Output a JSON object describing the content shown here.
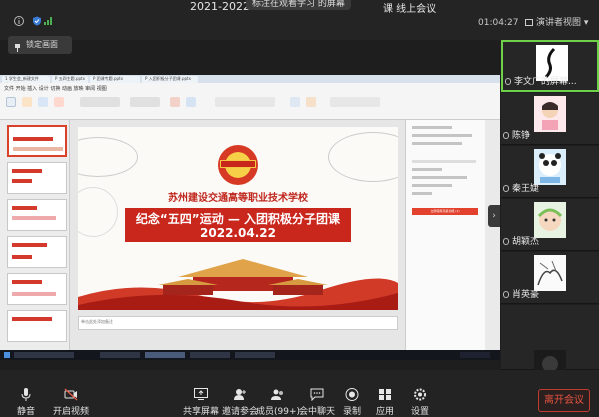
{
  "window": {
    "title_left": "2021-2022:",
    "recording_pill": "标注在观看学习 的屏幕",
    "title_right": "课 线上会议",
    "timer": "01:04:27",
    "view_label": "演讲者视图",
    "lock_label": "锁定画面"
  },
  "shared_screen": {
    "browser_tabs": [
      "1 学生会_新建文件夹.pptx",
      "P 五四主题.pptx",
      "P 团课专题.pptx",
      "P 入团积极分子团课.pptx"
    ],
    "menu_text": "文件 开始 插入 设计 切换 动画 放映 审阅 视图",
    "slide": {
      "school": "苏州建设交通高等职业技术学校",
      "title_line1": "纪念“五四”运动 — 入团积极分子团课",
      "title_line2": "2022.04.22"
    },
    "notes_placeholder": "单击此处添加备注",
    "panel_cta": "立即使用高级功能 (1)"
  },
  "participants": [
    {
      "name": "李文广的屏幕...",
      "speaker": true
    },
    {
      "name": "陈铮",
      "speaker": false
    },
    {
      "name": "秦王婕",
      "speaker": false
    },
    {
      "name": "胡颖杰",
      "speaker": false
    },
    {
      "name": "肖英豪",
      "speaker": false
    },
    {
      "name": "",
      "speaker": false
    }
  ],
  "toolbar": {
    "mute": "静音",
    "video": "开启视频",
    "share": "共享屏幕",
    "invite": "邀请参会",
    "members": "成员(99+)",
    "chat": "会中聊天",
    "record": "录制",
    "apps": "应用",
    "settings": "设置",
    "leave": "离开会议"
  },
  "colors": {
    "accent_red": "#c9261c",
    "speaker_border": "#6fd04a",
    "signal_green": "#4caf50",
    "shield_blue": "#3a7bd5"
  }
}
